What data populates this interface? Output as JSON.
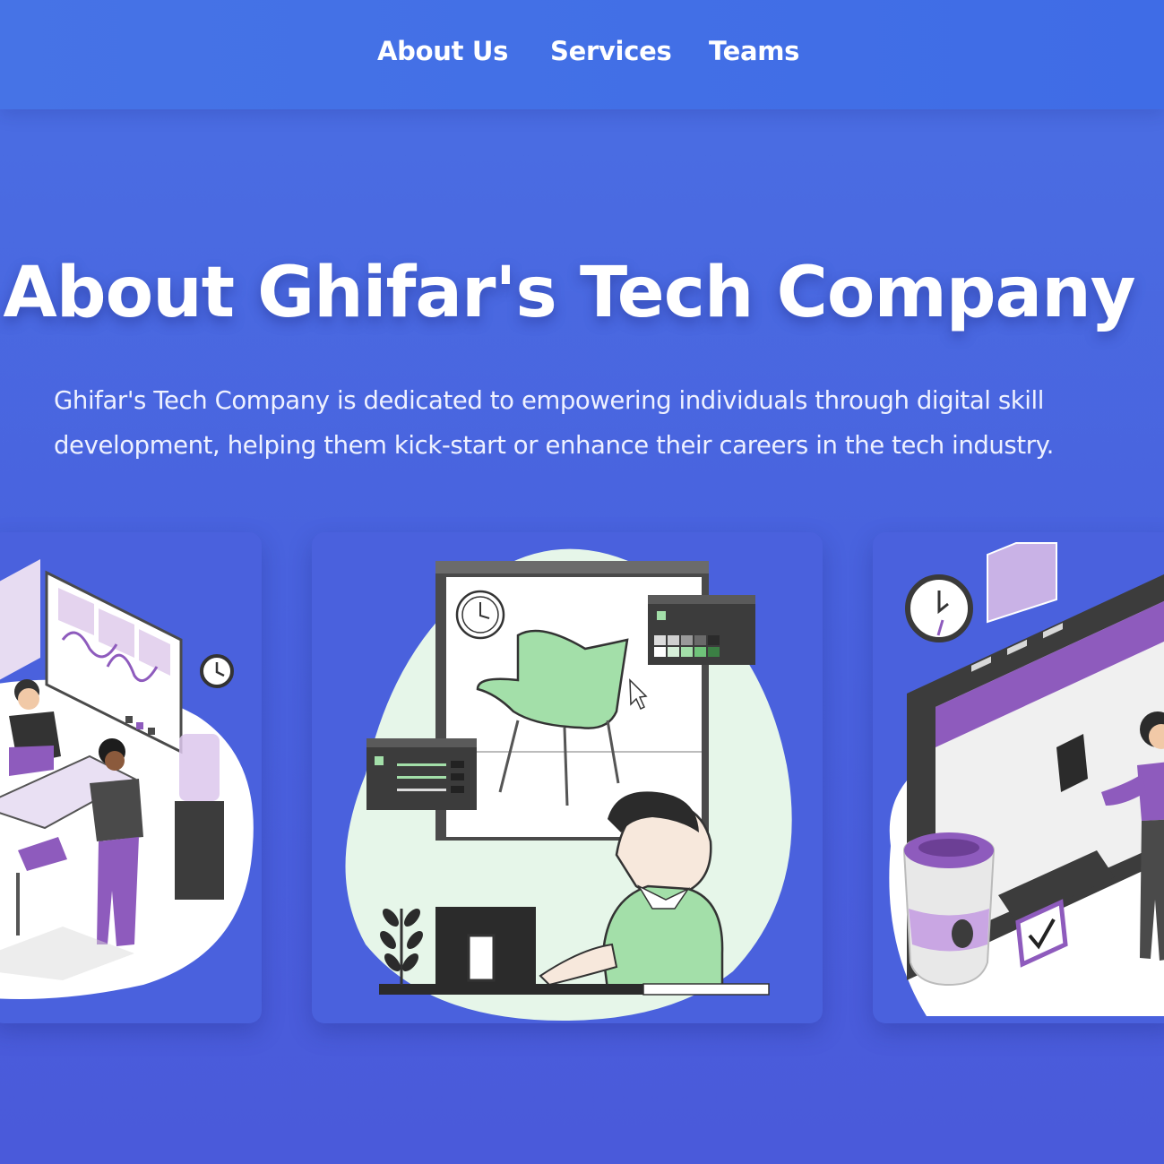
{
  "nav": {
    "links": [
      "About Us",
      "Services",
      "Teams"
    ]
  },
  "hero": {
    "title": "About Ghifar's Tech Company",
    "description": "Ghifar's Tech Company is dedicated to empowering individuals through digital skill development, helping them kick-start or enhance their careers in the tech industry."
  },
  "cards": [
    {
      "illustration": "team-meeting-illustration"
    },
    {
      "illustration": "designer-at-computer-illustration"
    },
    {
      "illustration": "puzzle-planning-illustration"
    }
  ],
  "colors": {
    "background": "#4962de",
    "navbar": "#4370e6",
    "card": "#4a61dd",
    "accent_purple": "#8e5bbd",
    "accent_green": "#a3dfa9"
  }
}
